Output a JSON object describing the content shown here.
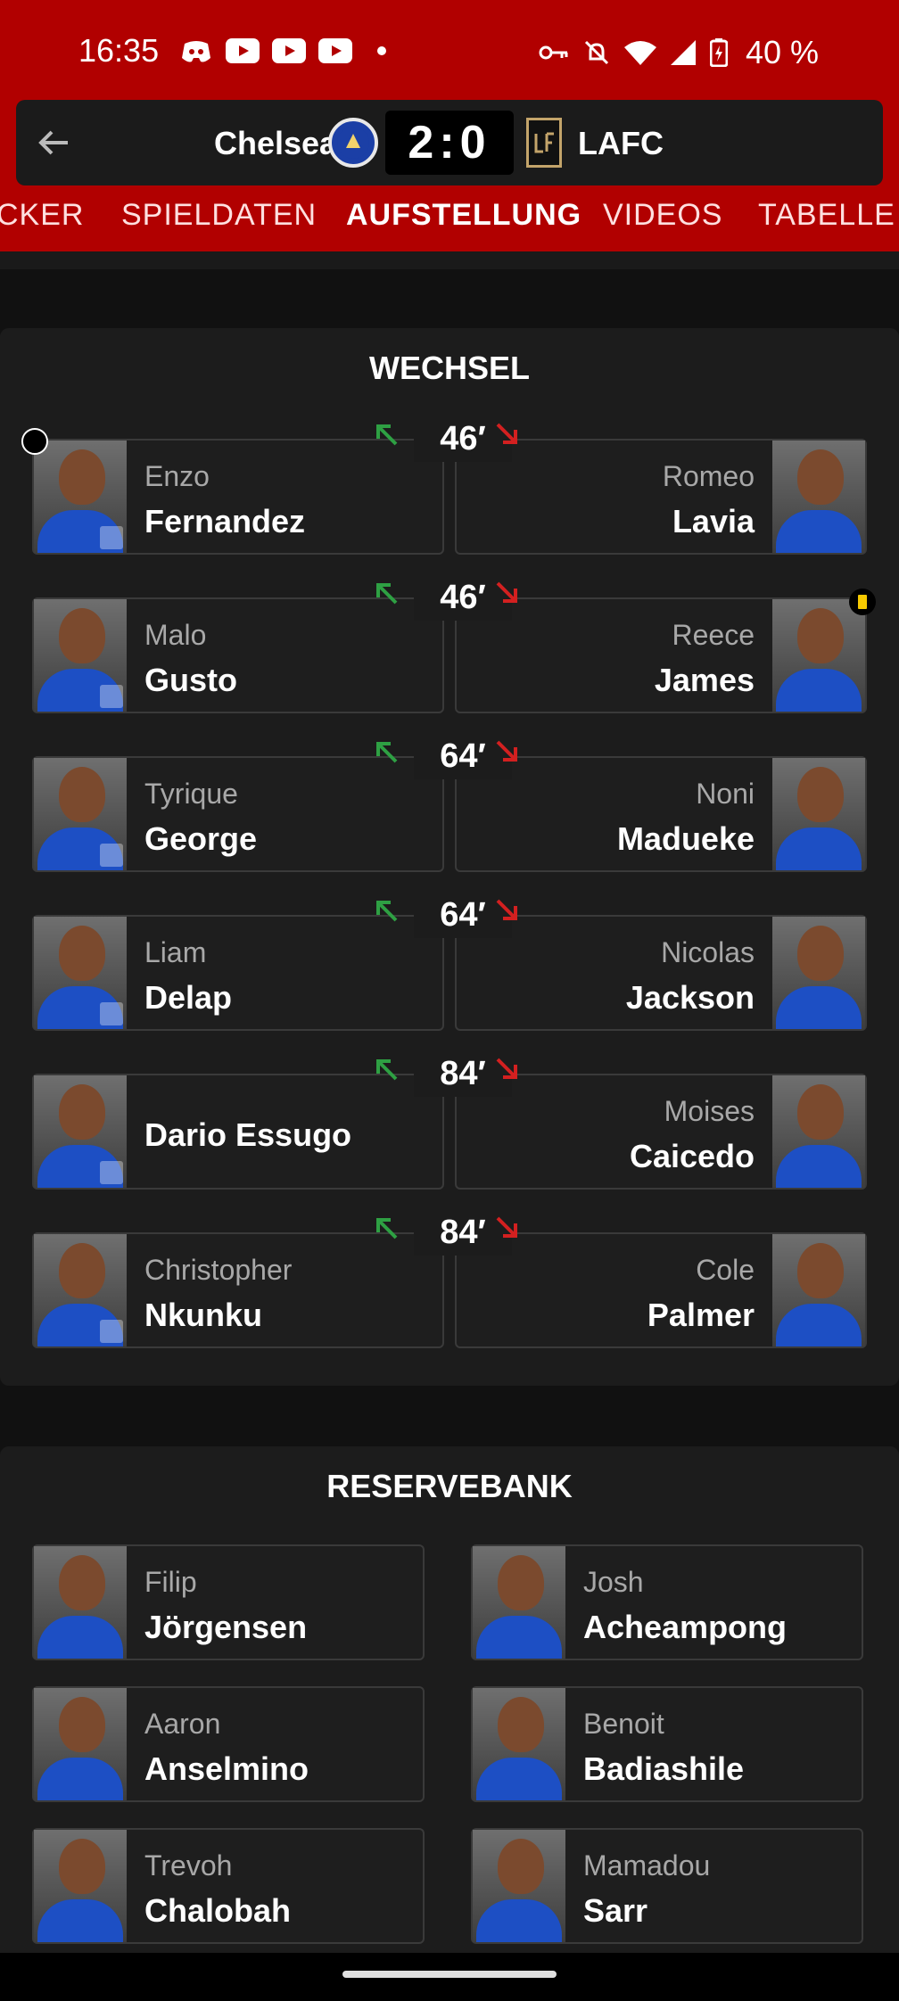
{
  "status_bar": {
    "time": "16:35",
    "battery": "40 %"
  },
  "match": {
    "home": "Chelsea",
    "score_home": "2",
    "score_sep": ":",
    "score_away": "0",
    "away": "LAFC"
  },
  "tabs": [
    "CKER",
    "SPIELDATEN",
    "AUFSTELLUNG",
    "VIDEOS",
    "TABELLE"
  ],
  "active_tab": "AUFSTELLUNG",
  "substitutions": {
    "title": "WECHSEL",
    "rows": [
      {
        "minute": "46′",
        "in_first": "Enzo",
        "in_last": "Fernandez",
        "out_first": "Romeo",
        "out_last": "Lavia",
        "in_event": "ball",
        "out_event": ""
      },
      {
        "minute": "46′",
        "in_first": "Malo",
        "in_last": "Gusto",
        "out_first": "Reece",
        "out_last": "James",
        "in_event": "",
        "out_event": "yellow-card"
      },
      {
        "minute": "64′",
        "in_first": "Tyrique",
        "in_last": "George",
        "out_first": "Noni",
        "out_last": "Madueke",
        "in_event": "",
        "out_event": ""
      },
      {
        "minute": "64′",
        "in_first": "Liam",
        "in_last": "Delap",
        "out_first": "Nicolas",
        "out_last": "Jackson",
        "in_event": "",
        "out_event": ""
      },
      {
        "minute": "84′",
        "in_first": "",
        "in_last": "Dario Essugo",
        "out_first": "Moises",
        "out_last": "Caicedo",
        "in_event": "",
        "out_event": ""
      },
      {
        "minute": "84′",
        "in_first": "Christopher",
        "in_last": "Nkunku",
        "out_first": "Cole",
        "out_last": "Palmer",
        "in_event": "",
        "out_event": ""
      }
    ]
  },
  "bench": {
    "title": "RESERVEBANK",
    "players": [
      {
        "first": "Filip",
        "last": "Jörgensen"
      },
      {
        "first": "Josh",
        "last": "Acheampong"
      },
      {
        "first": "Aaron",
        "last": "Anselmino"
      },
      {
        "first": "Benoit",
        "last": "Badiashile"
      },
      {
        "first": "Trevoh",
        "last": "Chalobah"
      },
      {
        "first": "Mamadou",
        "last": "Sarr"
      }
    ]
  },
  "colors": {
    "header_red": "#b10000",
    "arrow_in": "#2ea043",
    "arrow_out": "#d32020",
    "yellow_card": "#f6c900"
  }
}
